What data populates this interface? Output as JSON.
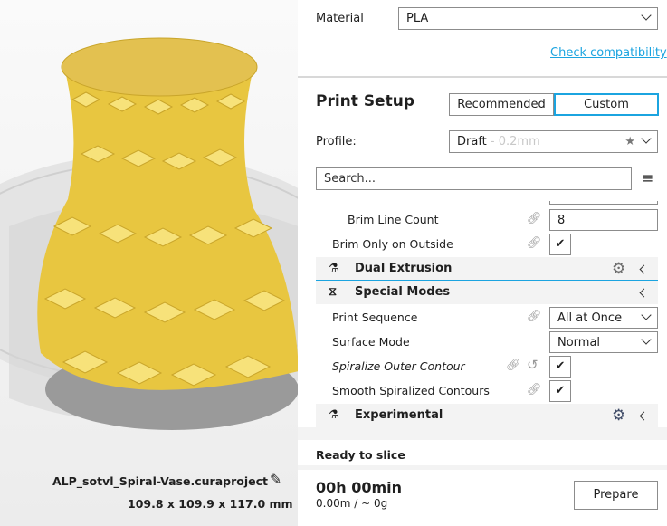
{
  "viewport": {
    "filename": "ALP_sotvl_Spiral-Vase.curaproject",
    "dimensions": "109.8 x 109.9 x 117.0 mm"
  },
  "material": {
    "label": "Material",
    "value": "PLA",
    "check_link": "Check compatibility"
  },
  "print_setup": {
    "title": "Print Setup",
    "tabs": [
      "Recommended",
      "Custom"
    ],
    "active_tab": "Custom",
    "accent": "#1ba4e0",
    "profile_label": "Profile:",
    "profile_name": "Draft",
    "profile_detail": " - 0.2mm",
    "search_placeholder": "Search..."
  },
  "settings": {
    "brim_line_count": {
      "label": "Brim Line Count",
      "value": "8"
    },
    "brim_only_outside": {
      "label": "Brim Only on Outside",
      "checked": true
    },
    "dual_extrusion": {
      "label": "Dual Extrusion"
    },
    "special_modes": {
      "label": "Special Modes"
    },
    "print_sequence": {
      "label": "Print Sequence",
      "value": "All at Once"
    },
    "surface_mode": {
      "label": "Surface Mode",
      "value": "Normal"
    },
    "spiralize": {
      "label": "Spiralize Outer Contour",
      "checked": true
    },
    "smooth_spiral": {
      "label": "Smooth Spiralized Contours",
      "checked": true
    },
    "experimental": {
      "label": "Experimental"
    }
  },
  "footer": {
    "status": "Ready to slice",
    "time": "00h 00min",
    "material_usage": "0.00m / ~ 0g",
    "prepare_button": "Prepare"
  }
}
